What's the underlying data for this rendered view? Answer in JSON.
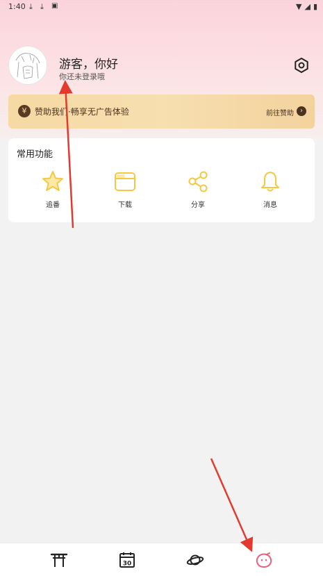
{
  "status_bar": {
    "time": "1:40",
    "icons": [
      "download-icon",
      "download-icon",
      "app-icon"
    ],
    "right_icons": [
      "wifi-icon",
      "signal-icon",
      "battery-icon"
    ]
  },
  "profile": {
    "greeting": "游客，你好",
    "subtitle": "你还未登录哦"
  },
  "banner": {
    "text": "赞助我们·畅享无广告体验",
    "link": "前往赞助",
    "yen_symbol": "¥"
  },
  "functions": {
    "title": "常用功能",
    "items": [
      {
        "label": "追番",
        "icon": "star-icon"
      },
      {
        "label": "下载",
        "icon": "folder-icon"
      },
      {
        "label": "分享",
        "icon": "share-icon"
      },
      {
        "label": "消息",
        "icon": "bell-icon"
      }
    ]
  },
  "bottom_nav": {
    "items": [
      "torii-icon",
      "calendar-icon",
      "planet-icon",
      "profile-face-icon"
    ],
    "calendar_day": "30",
    "active": 3,
    "active_color": "#e8607a"
  },
  "colors": {
    "accent_yellow": "#f5c842",
    "annotation_red": "#e23a2e"
  }
}
